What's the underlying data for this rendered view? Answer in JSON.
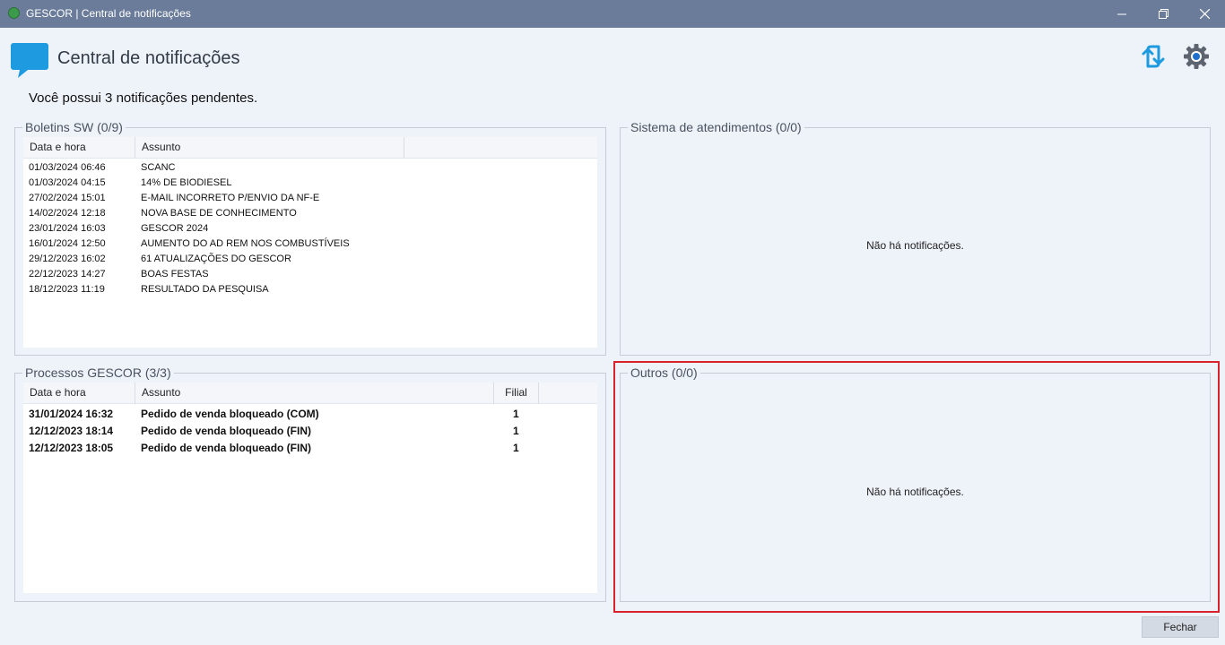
{
  "window": {
    "title": "GESCOR | Central de notificações",
    "controls": [
      "minimize",
      "restore",
      "close"
    ]
  },
  "header": {
    "title": "Central de notificações",
    "icon": "chat-bubble-icon",
    "refresh_icon": "refresh-icon",
    "settings_icon": "gear-icon"
  },
  "pending_text": "Você possui 3 notificações pendentes.",
  "boletins": {
    "legend": "Boletins SW (0/9)",
    "columns": [
      "Data e hora",
      "Assunto"
    ],
    "rows": [
      {
        "datetime": "01/03/2024 06:46",
        "subject": "SCANC"
      },
      {
        "datetime": "01/03/2024 04:15",
        "subject": "14% DE BIODIESEL"
      },
      {
        "datetime": "27/02/2024 15:01",
        "subject": "E-MAIL INCORRETO P/ENVIO DA NF-E"
      },
      {
        "datetime": "14/02/2024 12:18",
        "subject": "NOVA BASE DE CONHECIMENTO"
      },
      {
        "datetime": "23/01/2024 16:03",
        "subject": "GESCOR 2024"
      },
      {
        "datetime": "16/01/2024 12:50",
        "subject": "AUMENTO DO AD REM NOS COMBUSTÍVEIS"
      },
      {
        "datetime": "29/12/2023 16:02",
        "subject": "61 ATUALIZAÇÕES DO GESCOR"
      },
      {
        "datetime": "22/12/2023 14:27",
        "subject": "BOAS FESTAS"
      },
      {
        "datetime": "18/12/2023 11:19",
        "subject": "RESULTADO DA PESQUISA"
      }
    ]
  },
  "processos": {
    "legend": "Processos GESCOR (3/3)",
    "columns": [
      "Data e hora",
      "Assunto",
      "Filial"
    ],
    "rows": [
      {
        "datetime": "31/01/2024 16:32",
        "subject": "Pedido de venda bloqueado (COM)",
        "filial": "1"
      },
      {
        "datetime": "12/12/2023 18:14",
        "subject": "Pedido de venda bloqueado (FIN)",
        "filial": "1"
      },
      {
        "datetime": "12/12/2023 18:05",
        "subject": "Pedido de venda bloqueado (FIN)",
        "filial": "1"
      }
    ]
  },
  "atendimentos": {
    "legend": "Sistema de atendimentos (0/0)",
    "empty": "Não há notificações."
  },
  "outros": {
    "legend": "Outros (0/0)",
    "empty": "Não há notificações."
  },
  "footer": {
    "close_label": "Fechar"
  },
  "colors": {
    "titlebar": "#6a7c9a",
    "background": "#eef2f9",
    "accent_blue": "#1e9be0",
    "highlight": "#d9222c"
  }
}
